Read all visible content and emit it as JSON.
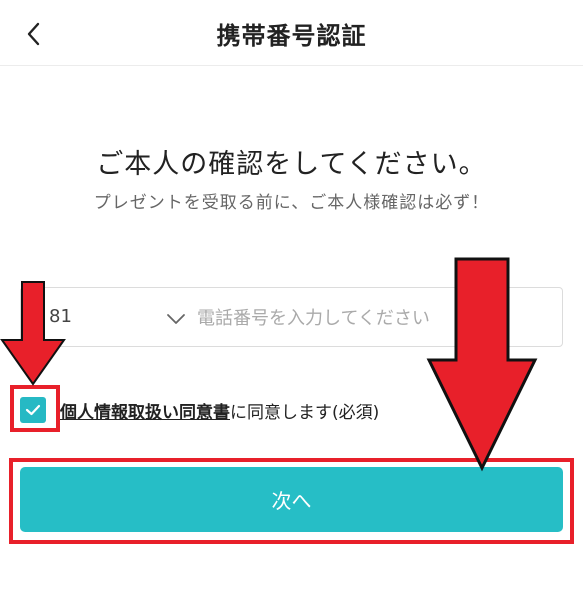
{
  "header": {
    "title": "携帯番号認証",
    "back_icon": "chevron-left-icon"
  },
  "main": {
    "heading": "ご本人の確認をしてください。",
    "subheading": "プレゼントを受取る前に、ご本人様確認は必ず！"
  },
  "phone": {
    "country_code": "81",
    "placeholder": "電話番号を入力してください"
  },
  "consent": {
    "checked": true,
    "link_label": "個人情報取扱い同意書",
    "text": "に同意します(必須)"
  },
  "next_button": {
    "label": "次へ"
  },
  "colors": {
    "accent": "#26bec6",
    "checkbox": "#26b9c4",
    "annotation_red": "#e8202a"
  }
}
